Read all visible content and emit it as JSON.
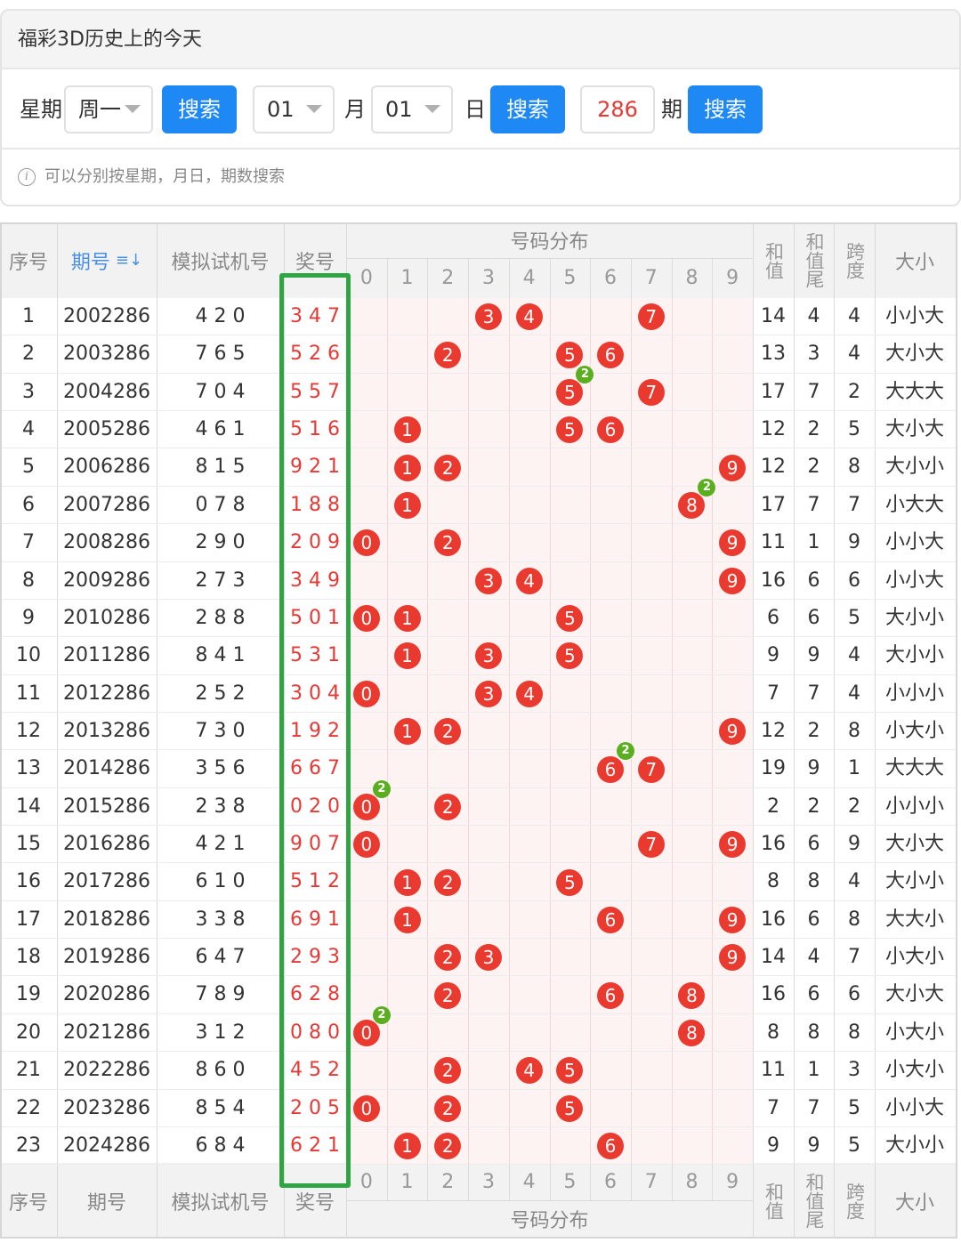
{
  "header": {
    "title": "福彩3D历史上的今天"
  },
  "search": {
    "weekday_label": "星期",
    "weekday_value": "周一",
    "search_label": "搜索",
    "month_value": "01",
    "month_label": "月",
    "day_value": "01",
    "day_label": "日",
    "issue_value": "286",
    "issue_label": "期",
    "hint": "可以分别按星期，月日，期数搜索"
  },
  "table": {
    "headers": {
      "index": "序号",
      "issue": "期号",
      "sort_icon": "≡↓",
      "machine": "模拟试机号",
      "prize": "奖号",
      "distribution": "号码分布",
      "sum": "和值",
      "sum_tail": "和值尾",
      "span": "跨度",
      "size": "大小"
    },
    "digits": [
      "0",
      "1",
      "2",
      "3",
      "4",
      "5",
      "6",
      "7",
      "8",
      "9"
    ],
    "rows": [
      {
        "idx": "1",
        "issue": "2002286",
        "machine": "4 2 0",
        "prize": "3 4 7",
        "balls": [
          3,
          4,
          7
        ],
        "repeat": null,
        "sum": "14",
        "tail": "4",
        "span": "4",
        "size": "小小大"
      },
      {
        "idx": "2",
        "issue": "2003286",
        "machine": "7 6 5",
        "prize": "5 2 6",
        "balls": [
          2,
          5,
          6
        ],
        "repeat": null,
        "sum": "13",
        "tail": "3",
        "span": "4",
        "size": "大小大"
      },
      {
        "idx": "3",
        "issue": "2004286",
        "machine": "7 0 4",
        "prize": "5 5 7",
        "balls": [
          5,
          7
        ],
        "repeat": {
          "digit": 5,
          "count": "2"
        },
        "sum": "17",
        "tail": "7",
        "span": "2",
        "size": "大大大"
      },
      {
        "idx": "4",
        "issue": "2005286",
        "machine": "4 6 1",
        "prize": "5 1 6",
        "balls": [
          1,
          5,
          6
        ],
        "repeat": null,
        "sum": "12",
        "tail": "2",
        "span": "5",
        "size": "大小大"
      },
      {
        "idx": "5",
        "issue": "2006286",
        "machine": "8 1 5",
        "prize": "9 2 1",
        "balls": [
          1,
          2,
          9
        ],
        "repeat": null,
        "sum": "12",
        "tail": "2",
        "span": "8",
        "size": "大小小"
      },
      {
        "idx": "6",
        "issue": "2007286",
        "machine": "0 7 8",
        "prize": "1 8 8",
        "balls": [
          1,
          8
        ],
        "repeat": {
          "digit": 8,
          "count": "2"
        },
        "sum": "17",
        "tail": "7",
        "span": "7",
        "size": "小大大"
      },
      {
        "idx": "7",
        "issue": "2008286",
        "machine": "2 9 0",
        "prize": "2 0 9",
        "balls": [
          0,
          2,
          9
        ],
        "repeat": null,
        "sum": "11",
        "tail": "1",
        "span": "9",
        "size": "小小大"
      },
      {
        "idx": "8",
        "issue": "2009286",
        "machine": "2 7 3",
        "prize": "3 4 9",
        "balls": [
          3,
          4,
          9
        ],
        "repeat": null,
        "sum": "16",
        "tail": "6",
        "span": "6",
        "size": "小小大"
      },
      {
        "idx": "9",
        "issue": "2010286",
        "machine": "2 8 8",
        "prize": "5 0 1",
        "balls": [
          0,
          1,
          5
        ],
        "repeat": null,
        "sum": "6",
        "tail": "6",
        "span": "5",
        "size": "大小小"
      },
      {
        "idx": "10",
        "issue": "2011286",
        "machine": "8 4 1",
        "prize": "5 3 1",
        "balls": [
          1,
          3,
          5
        ],
        "repeat": null,
        "sum": "9",
        "tail": "9",
        "span": "4",
        "size": "大小小"
      },
      {
        "idx": "11",
        "issue": "2012286",
        "machine": "2 5 2",
        "prize": "3 0 4",
        "balls": [
          0,
          3,
          4
        ],
        "repeat": null,
        "sum": "7",
        "tail": "7",
        "span": "4",
        "size": "小小小"
      },
      {
        "idx": "12",
        "issue": "2013286",
        "machine": "7 3 0",
        "prize": "1 9 2",
        "balls": [
          1,
          2,
          9
        ],
        "repeat": null,
        "sum": "12",
        "tail": "2",
        "span": "8",
        "size": "小大小"
      },
      {
        "idx": "13",
        "issue": "2014286",
        "machine": "3 5 6",
        "prize": "6 6 7",
        "balls": [
          6,
          7
        ],
        "repeat": {
          "digit": 6,
          "count": "2"
        },
        "sum": "19",
        "tail": "9",
        "span": "1",
        "size": "大大大"
      },
      {
        "idx": "14",
        "issue": "2015286",
        "machine": "2 3 8",
        "prize": "0 2 0",
        "balls": [
          0,
          2
        ],
        "repeat": {
          "digit": 0,
          "count": "2"
        },
        "sum": "2",
        "tail": "2",
        "span": "2",
        "size": "小小小"
      },
      {
        "idx": "15",
        "issue": "2016286",
        "machine": "4 2 1",
        "prize": "9 0 7",
        "balls": [
          0,
          7,
          9
        ],
        "repeat": null,
        "sum": "16",
        "tail": "6",
        "span": "9",
        "size": "大小大"
      },
      {
        "idx": "16",
        "issue": "2017286",
        "machine": "6 1 0",
        "prize": "5 1 2",
        "balls": [
          1,
          2,
          5
        ],
        "repeat": null,
        "sum": "8",
        "tail": "8",
        "span": "4",
        "size": "大小小"
      },
      {
        "idx": "17",
        "issue": "2018286",
        "machine": "3 3 8",
        "prize": "6 9 1",
        "balls": [
          1,
          6,
          9
        ],
        "repeat": null,
        "sum": "16",
        "tail": "6",
        "span": "8",
        "size": "大大小"
      },
      {
        "idx": "18",
        "issue": "2019286",
        "machine": "6 4 7",
        "prize": "2 9 3",
        "balls": [
          2,
          3,
          9
        ],
        "repeat": null,
        "sum": "14",
        "tail": "4",
        "span": "7",
        "size": "小大小"
      },
      {
        "idx": "19",
        "issue": "2020286",
        "machine": "7 8 9",
        "prize": "6 2 8",
        "balls": [
          2,
          6,
          8
        ],
        "repeat": null,
        "sum": "16",
        "tail": "6",
        "span": "6",
        "size": "大小大"
      },
      {
        "idx": "20",
        "issue": "2021286",
        "machine": "3 1 2",
        "prize": "0 8 0",
        "balls": [
          0,
          8
        ],
        "repeat": {
          "digit": 0,
          "count": "2"
        },
        "sum": "8",
        "tail": "8",
        "span": "8",
        "size": "小大小"
      },
      {
        "idx": "21",
        "issue": "2022286",
        "machine": "8 6 0",
        "prize": "4 5 2",
        "balls": [
          2,
          4,
          5
        ],
        "repeat": null,
        "sum": "11",
        "tail": "1",
        "span": "3",
        "size": "小大小"
      },
      {
        "idx": "22",
        "issue": "2023286",
        "machine": "8 5 4",
        "prize": "2 0 5",
        "balls": [
          0,
          2,
          5
        ],
        "repeat": null,
        "sum": "7",
        "tail": "7",
        "span": "5",
        "size": "小小大"
      },
      {
        "idx": "23",
        "issue": "2024286",
        "machine": "6 8 4",
        "prize": "6 2 1",
        "balls": [
          1,
          2,
          6
        ],
        "repeat": null,
        "sum": "9",
        "tail": "9",
        "span": "5",
        "size": "大小小"
      }
    ]
  },
  "colors": {
    "accent": "#1e88f5",
    "ball": "#ea3a2f",
    "repeat_badge": "#5aae1f",
    "highlight_frame": "#2fa443",
    "prize_text": "#e53935"
  }
}
